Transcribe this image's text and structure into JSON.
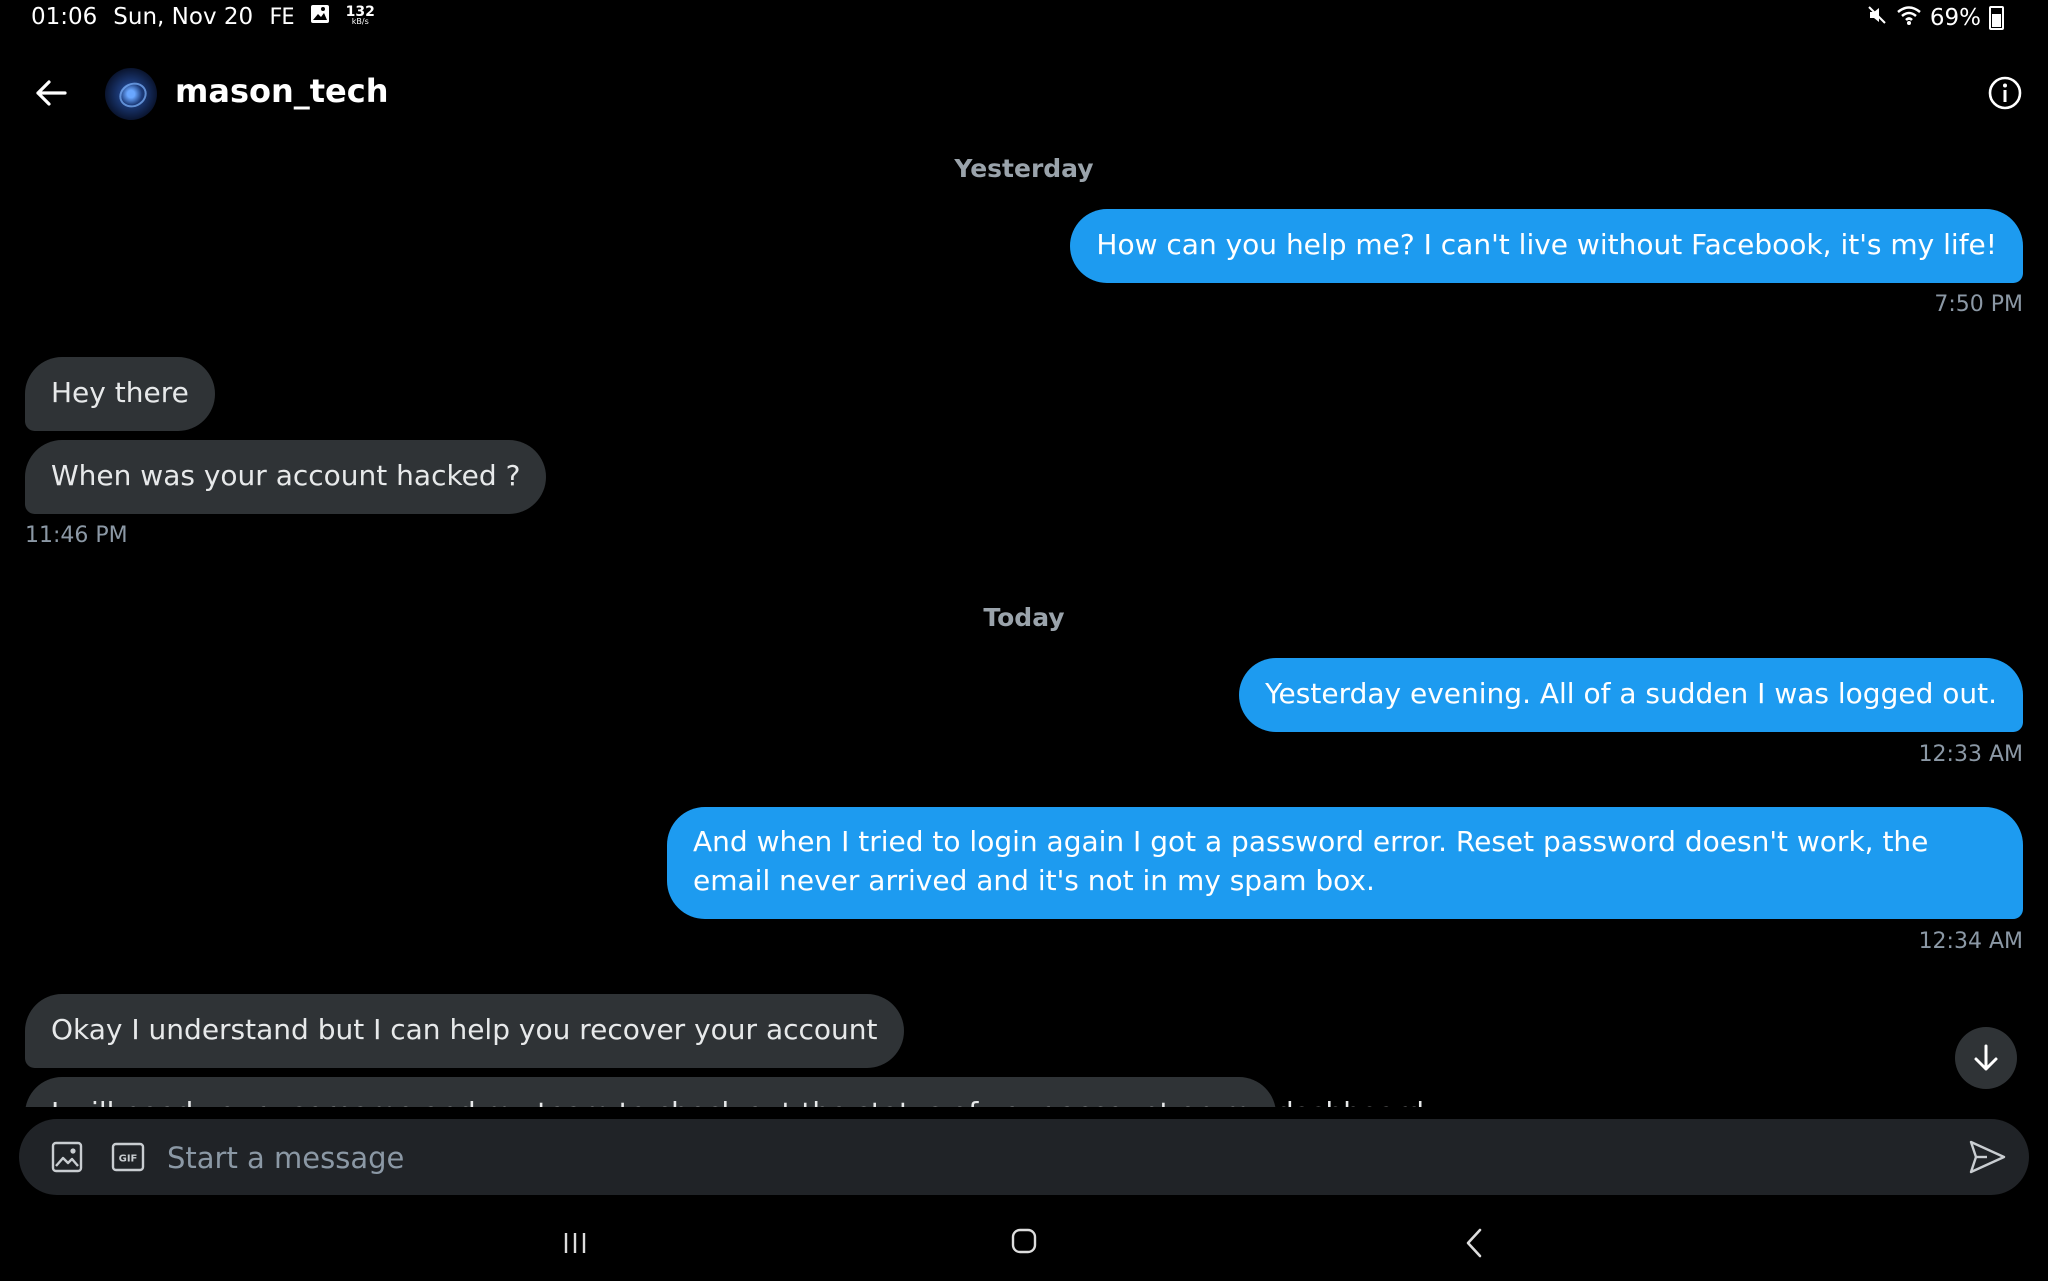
{
  "status_bar": {
    "time": "01:06",
    "date": "Sun, Nov 20",
    "fe_label": "FE",
    "net_speed": "132",
    "net_unit": "kB/s",
    "battery": "69%"
  },
  "header": {
    "username": "mason_tech"
  },
  "chat": {
    "day1": "Yesterday",
    "day2": "Today",
    "messages": [
      {
        "text": "How can you help me? I can't live without Facebook, it's my life!",
        "time": "7:50 PM"
      },
      {
        "text": "Hey there"
      },
      {
        "text": "When was your account hacked ?",
        "time": "11:46 PM"
      },
      {
        "text": "Yesterday evening. All of a sudden I was logged out.",
        "time": "12:33 AM"
      },
      {
        "text": "And when I tried to login again I got a password error. Reset password doesn't work, the email never arrived and it's not in my spam box.",
        "time": "12:34 AM"
      },
      {
        "text": "Okay I understand but I can help you recover your account"
      },
      {
        "text": "I will need your username and my team to check out the status of your account on my dashboard"
      }
    ]
  },
  "composer": {
    "placeholder": "Start a message",
    "gif_label": "GIF"
  },
  "colors": {
    "outgoing_bubble": "#1d9bf0",
    "incoming_bubble": "#2f3336",
    "background": "#000000"
  }
}
